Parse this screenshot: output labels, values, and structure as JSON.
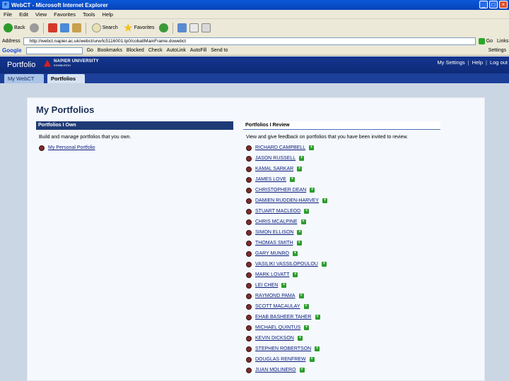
{
  "window": {
    "title": "WebCT - Microsoft Internet Explorer",
    "app_icon": "e"
  },
  "menubar": {
    "items": [
      "File",
      "Edit",
      "View",
      "Favorites",
      "Tools",
      "Help"
    ]
  },
  "toolbar": {
    "back": "Back",
    "search": "Search",
    "favorites": "Favorites"
  },
  "addressbar": {
    "label": "Address",
    "url": "http://webct.napier.ac.uk/webct/urw/lc5116001.tp0/cobaltMainFrame.dowebct",
    "go": "Go",
    "links": "Links"
  },
  "googlebar": {
    "logo": "Google",
    "items": [
      "Go",
      "Bookmarks",
      "Blocked",
      "Check",
      "AutoLink",
      "AutoFill",
      "Send to",
      "Settings"
    ]
  },
  "portal": {
    "title": "Portfolio",
    "brand_line1": "NAPIER UNIVERSITY",
    "brand_line2": "EDINBURGH",
    "links": [
      "My Settings",
      "Help",
      "Log out"
    ],
    "tabs": [
      "My WebCT",
      "Portfolios"
    ]
  },
  "page": {
    "title": "My Portfolios",
    "own": {
      "header": "Portfolios I Own",
      "description": "Build and manage portfolios that you own.",
      "items": [
        "My Personal Portfolio"
      ]
    },
    "review": {
      "header": "Portfolios I Review",
      "description": "View and give feedback on portfolios that you have been invited to review.",
      "items": [
        "RICHARD CAMPBELL",
        "JASON RUSSELL",
        "KAMAL SARKAR",
        "JAMES LOVE",
        "CHRISTOPHER DEAN",
        "DAMIEN RUDDEN-HARVEY",
        "STUART MACLEOD",
        "CHRIS MCALPINE",
        "SIMON ELLISON",
        "THOMAS SMITH",
        "GARY MUNRO",
        "VASILIKI VASSILOPOULOU",
        "MARK LOVATT",
        "LEI CHEN",
        "RAYMOND PAMA",
        "SCOTT MACAULAY",
        "EHAB BASHEER TAHER",
        "MICHAEL QUINTUS",
        "KEVIN DICKSON",
        "STEPHEN ROBERTSON",
        "DOUGLAS RENFREW",
        "JUAN MOLINERO"
      ]
    }
  },
  "colors": {
    "header_blue": "#14368e",
    "tab_blue": "#1c3f9a",
    "panel_blue": "#cbd6e4",
    "own_header": "#1e3a76",
    "link": "#0a1c7a",
    "plus_green": "#2c9c2c"
  }
}
